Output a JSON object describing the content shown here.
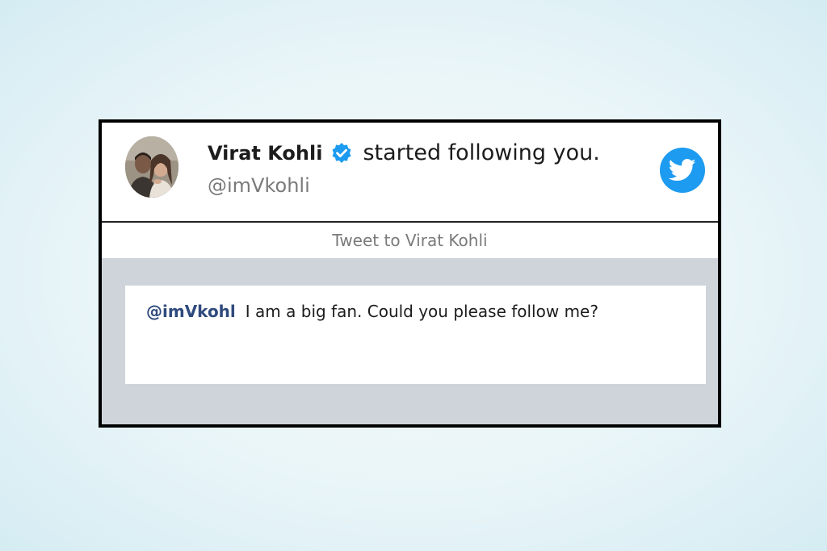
{
  "notification": {
    "user_name": "Virat Kohli",
    "action_text": "started following you.",
    "handle": "@imVkohli",
    "avatar_icon": "avatar-photo",
    "verified_icon": "verified-badge-icon",
    "app_icon": "twitter-bird-icon"
  },
  "tweet_to": {
    "label": "Tweet to Virat Kohli"
  },
  "compose": {
    "mention": "@imVkohl",
    "message": "I am a big fan. Could you please follow me?"
  },
  "colors": {
    "twitter_blue": "#1d9bf0",
    "mention_blue": "#2f4a7d",
    "panel_gray": "#cfd3da",
    "card_border": "#000000"
  }
}
